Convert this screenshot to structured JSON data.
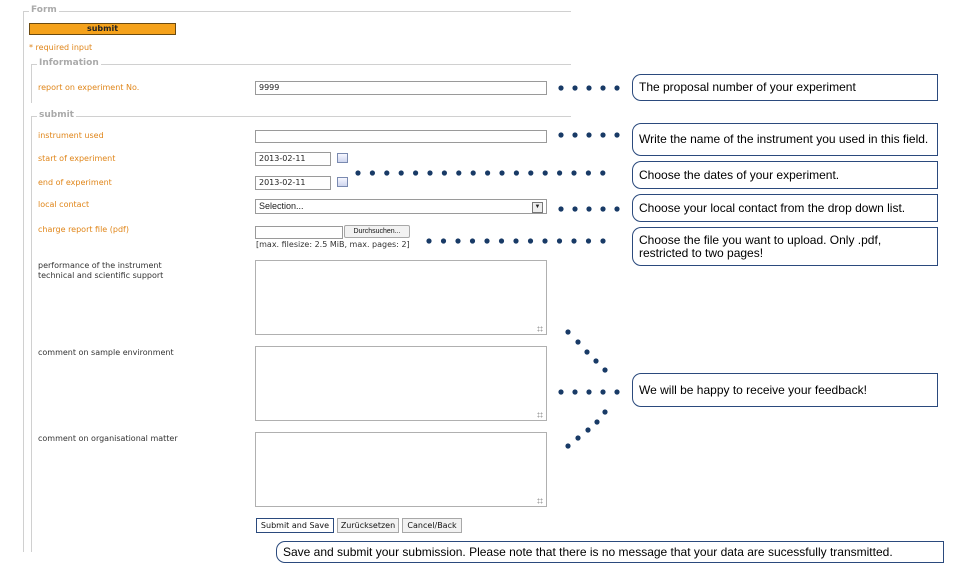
{
  "form": {
    "legend": "Form",
    "submit_label": "submit",
    "required_note": "* required input",
    "information": {
      "legend": "Information",
      "report_label": "report on experiment No.",
      "report_value": "9999"
    },
    "submit_section": {
      "legend": "submit",
      "instrument_label": "instrument used",
      "instrument_value": "",
      "start_label": "start of experiment",
      "start_value": "2013-02-11",
      "end_label": "end of experiment",
      "end_value": "2013-02-11",
      "contact_label": "local contact",
      "contact_value": "Selection...",
      "file_label": "charge report file (pdf)",
      "browse_label": "Durchsuchen...",
      "file_hint": "[max. filesize: 2.5 MiB, max. pages: 2]",
      "performance_label": "performance of the instrument technical and scientific support",
      "sample_label": "comment on sample environment",
      "organisational_label": "comment on organisational matter"
    },
    "buttons": {
      "submit_save": "Submit and Save",
      "reset": "Zurücksetzen",
      "cancel": "Cancel/Back"
    }
  },
  "callouts": {
    "proposal": "The proposal number of your experiment",
    "instrument": "Write the name of the instrument you used in this field.",
    "dates": "Choose the dates of your experiment.",
    "contact": "Choose your local contact from the drop down list.",
    "file": "Choose the file you want to upload. Only .pdf, restricted to two pages!",
    "feedback": "We will be happy to receive your feedback!",
    "save": "Save and submit your submission. Please note that there is no message that your data are sucessfully transmitted."
  },
  "colors": {
    "accent_orange": "#e0861a",
    "submit_bar": "#f5a21b",
    "callout_border": "#2b4a7d",
    "dot_color": "#183a66"
  }
}
